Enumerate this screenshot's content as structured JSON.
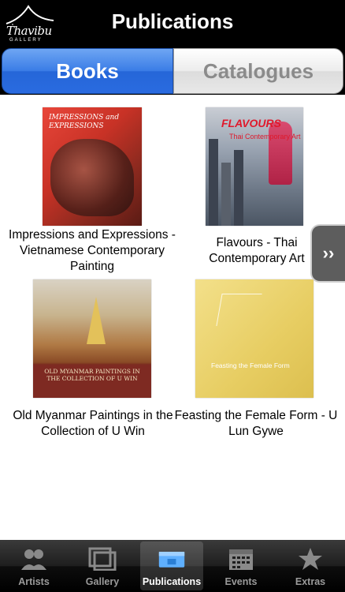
{
  "app": {
    "title": "Publications",
    "logo_text": "Thavibu",
    "logo_sub": "GALLERY"
  },
  "segmented": {
    "books": "Books",
    "catalogues": "Catalogues",
    "selected": "Books"
  },
  "books": [
    {
      "label": "Impressions and Expressions - Vietnamese Contemporary Painting",
      "cover_title": "IMPRESSIONS and EXPRESSIONS",
      "cover_sub": "Vietnamese Contemporary Painting"
    },
    {
      "label": "Flavours - Thai Contemporary Art",
      "cover_title": "FLAVOURS",
      "cover_sub": "Thai Contemporary Art"
    },
    {
      "label": "Old Myanmar Paintings in the Collection of U Win",
      "cover_title": "OLD MYANMAR PAINTINGS IN THE COLLECTION OF U WIN"
    },
    {
      "label": "Feasting the Female Form - U Lun Gywe",
      "cover_title": "Feasting the Female Form"
    }
  ],
  "side_arrow": "››",
  "tabs": [
    {
      "label": "Artists",
      "icon": "artists-icon"
    },
    {
      "label": "Gallery",
      "icon": "gallery-icon"
    },
    {
      "label": "Publications",
      "icon": "publications-icon",
      "active": true
    },
    {
      "label": "Events",
      "icon": "events-icon"
    },
    {
      "label": "Extras",
      "icon": "extras-icon"
    }
  ],
  "colors": {
    "nav_bg": "#000000",
    "segment_active": "#3a7ce6",
    "tab_active_icon": "#5fb0ff"
  }
}
